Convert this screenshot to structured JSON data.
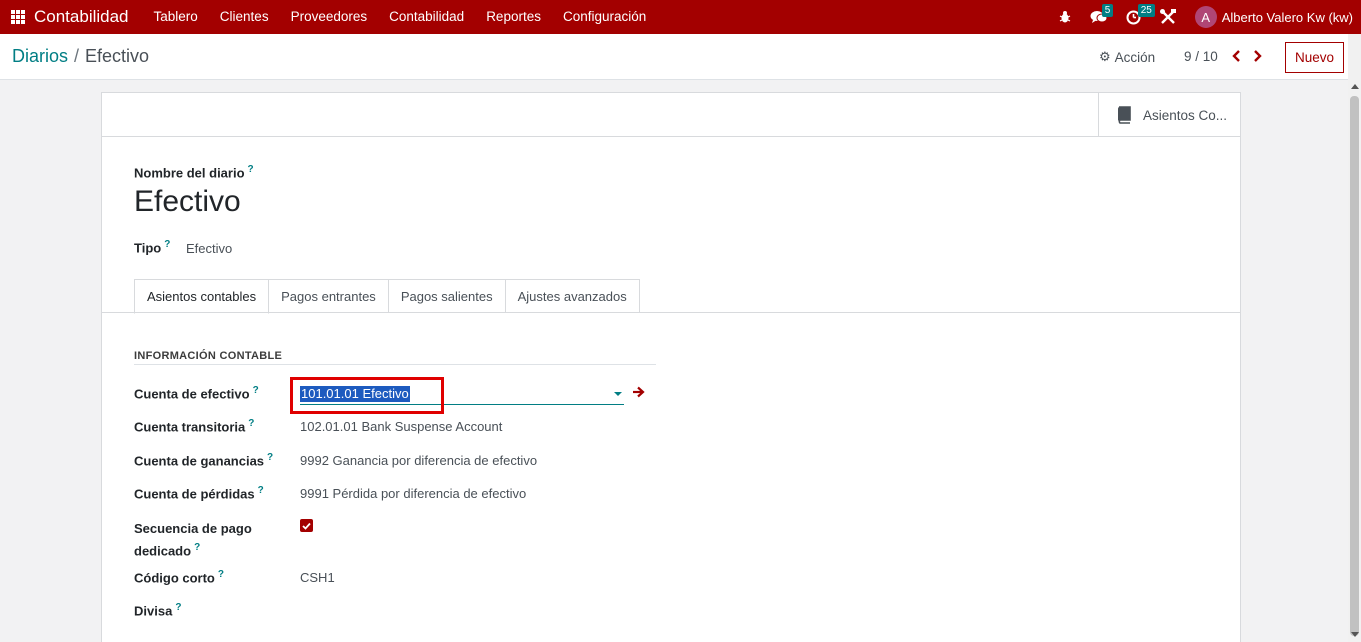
{
  "topbar": {
    "app_name": "Contabilidad",
    "menu": [
      "Tablero",
      "Clientes",
      "Proveedores",
      "Contabilidad",
      "Reportes",
      "Configuración"
    ],
    "messages_badge": "5",
    "activities_badge": "25",
    "avatar_letter": "A",
    "user_name": "Alberto Valero Kw (kw)"
  },
  "control": {
    "breadcrumb_parent": "Diarios",
    "breadcrumb_sep": "/",
    "breadcrumb_current": "Efectivo",
    "action_label": "Acción",
    "pager": "9 / 10",
    "new_button": "Nuevo"
  },
  "form": {
    "smart_button": "Asientos Co...",
    "name_label": "Nombre del diario",
    "name_value": "Efectivo",
    "type_label": "Tipo",
    "type_value": "Efectivo",
    "help_mark": "?",
    "tabs": [
      "Asientos contables",
      "Pagos entrantes",
      "Pagos salientes",
      "Ajustes avanzados"
    ],
    "section_title": "INFORMACIÓN CONTABLE",
    "fields": {
      "cash_account_label": "Cuenta de efectivo",
      "cash_account_value": "101.01.01 Efectivo",
      "suspense_label": "Cuenta transitoria",
      "suspense_value": "102.01.01 Bank Suspense Account",
      "profit_label": "Cuenta de ganancias",
      "profit_value": "9992 Ganancia por diferencia de efectivo",
      "loss_label": "Cuenta de pérdidas",
      "loss_value": "9991 Pérdida por diferencia de efectivo",
      "sequence_label_1": "Secuencia de pago",
      "sequence_label_2": "dedicado",
      "code_label": "Código corto",
      "code_value": "CSH1",
      "currency_label": "Divisa"
    }
  },
  "colors": {
    "brand": "#a30000",
    "accent": "#017e84",
    "highlight": "#e00000"
  }
}
